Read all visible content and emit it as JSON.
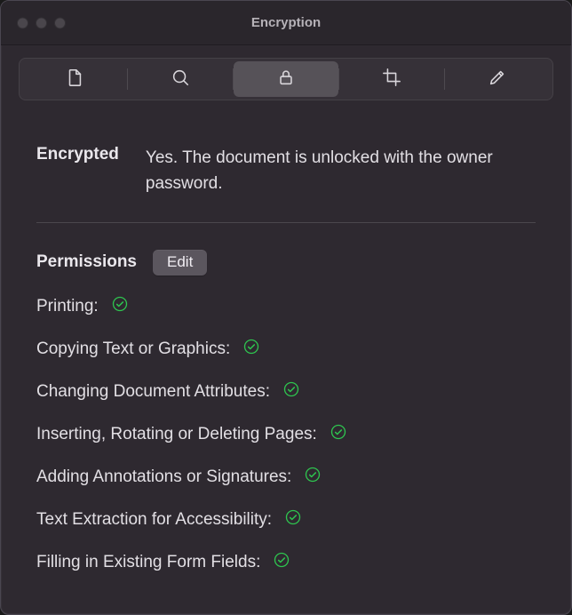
{
  "window": {
    "title": "Encryption"
  },
  "toolbar": {
    "tabs": [
      "document",
      "search",
      "encryption",
      "crop",
      "edit"
    ],
    "active_index": 2
  },
  "encrypted": {
    "label": "Encrypted",
    "value": "Yes. The document is unlocked with the owner password."
  },
  "permissions": {
    "label": "Permissions",
    "edit_button": "Edit",
    "items": [
      {
        "label": "Printing:",
        "allowed": true
      },
      {
        "label": "Copying Text or Graphics:",
        "allowed": true
      },
      {
        "label": "Changing Document Attributes:",
        "allowed": true
      },
      {
        "label": "Inserting, Rotating or Deleting Pages:",
        "allowed": true
      },
      {
        "label": "Adding Annotations or Signatures:",
        "allowed": true
      },
      {
        "label": "Text Extraction for Accessibility:",
        "allowed": true
      },
      {
        "label": "Filling in Existing Form Fields:",
        "allowed": true
      }
    ]
  }
}
